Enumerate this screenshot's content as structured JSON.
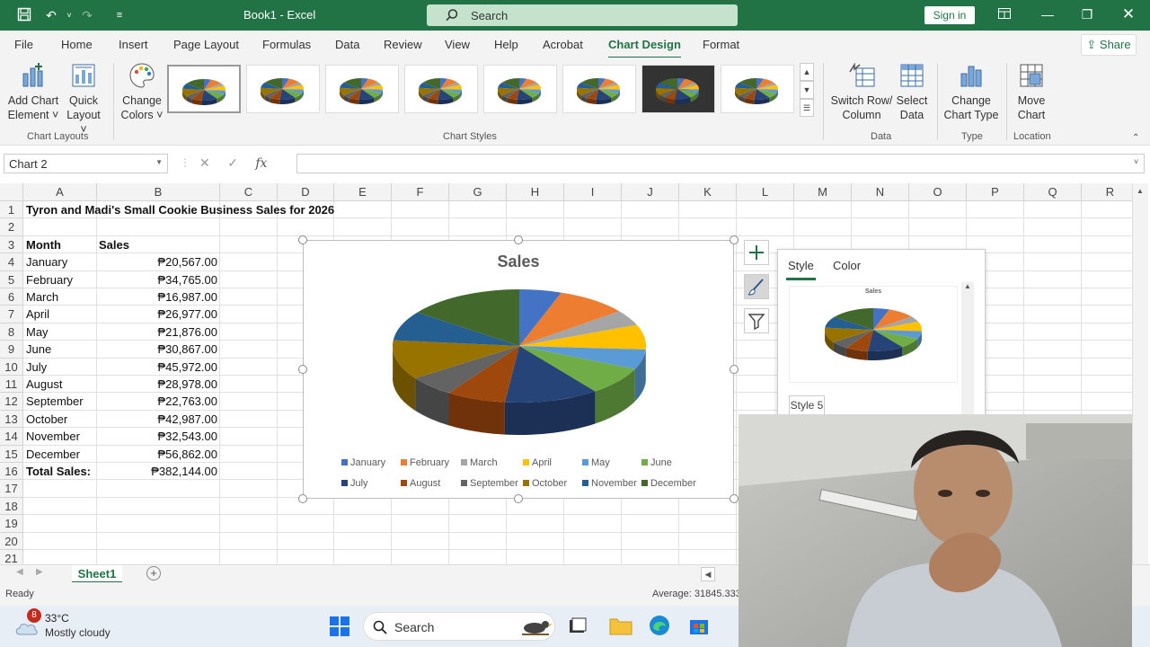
{
  "titlebar": {
    "title": "Book1  -  Excel",
    "search_placeholder": "Search",
    "signin_label": "Sign in"
  },
  "menu": {
    "tabs": [
      "File",
      "Home",
      "Insert",
      "Page Layout",
      "Formulas",
      "Data",
      "Review",
      "View",
      "Help",
      "Acrobat",
      "Chart Design",
      "Format"
    ],
    "active": "Chart Design",
    "share_label": "Share"
  },
  "ribbon": {
    "add_chart_element": [
      "Add Chart",
      "Element ˅"
    ],
    "quick_layout": [
      "Quick",
      "Layout ˅"
    ],
    "change_colors": [
      "Change",
      "Colors ˅"
    ],
    "chart_layouts_group": "Chart Layouts",
    "chart_styles_group": "Chart Styles",
    "switch_row_column": [
      "Switch Row/",
      "Column"
    ],
    "select_data": [
      "Select",
      "Data"
    ],
    "data_group": "Data",
    "change_chart_type": [
      "Change",
      "Chart Type"
    ],
    "type_group": "Type",
    "move_chart": [
      "Move",
      "Chart"
    ],
    "location_group": "Location"
  },
  "formula": {
    "name_box": "Chart 2",
    "fx": "fx"
  },
  "columns": [
    "A",
    "B",
    "C",
    "D",
    "E",
    "F",
    "G",
    "H",
    "I",
    "J",
    "K",
    "L",
    "M",
    "N",
    "O",
    "P",
    "Q",
    "R"
  ],
  "rows": [
    "1",
    "2",
    "3",
    "4",
    "5",
    "6",
    "7",
    "8",
    "9",
    "10",
    "11",
    "12",
    "13",
    "14",
    "15",
    "16",
    "17",
    "18",
    "19",
    "20",
    "21"
  ],
  "sheet": {
    "title": "Tyron and Madi's Small Cookie Business Sales for 2026",
    "header_month": "Month",
    "header_sales": "Sales",
    "data": [
      {
        "month": "January",
        "sales": "₱20,567.00"
      },
      {
        "month": "February",
        "sales": "₱34,765.00"
      },
      {
        "month": "March",
        "sales": "₱16,987.00"
      },
      {
        "month": "April",
        "sales": "₱26,977.00"
      },
      {
        "month": "May",
        "sales": "₱21,876.00"
      },
      {
        "month": "June",
        "sales": "₱30,867.00"
      },
      {
        "month": "July",
        "sales": "₱45,972.00"
      },
      {
        "month": "August",
        "sales": "₱28,978.00"
      },
      {
        "month": "September",
        "sales": "₱22,763.00"
      },
      {
        "month": "October",
        "sales": "₱42,987.00"
      },
      {
        "month": "November",
        "sales": "₱32,543.00"
      },
      {
        "month": "December",
        "sales": "₱56,862.00"
      }
    ],
    "total_label": "Total Sales:",
    "total_value": "₱382,144.00"
  },
  "chart_data": {
    "type": "pie",
    "title": "Sales",
    "categories": [
      "January",
      "February",
      "March",
      "April",
      "May",
      "June",
      "July",
      "August",
      "September",
      "October",
      "November",
      "December"
    ],
    "values": [
      20567,
      34765,
      16987,
      26977,
      21876,
      30867,
      45972,
      28978,
      22763,
      42987,
      32543,
      56862
    ],
    "colors": [
      "#4472c4",
      "#ed7d31",
      "#a5a5a5",
      "#ffc000",
      "#5b9bd5",
      "#70ad47",
      "#264478",
      "#9e480e",
      "#636363",
      "#997300",
      "#255e91",
      "#43682b"
    ],
    "legend_position": "bottom"
  },
  "style_pane": {
    "tabs": [
      "Style",
      "Color"
    ],
    "active": "Style",
    "hover_label": "Style 5",
    "thumb_title": "Sales"
  },
  "sheet_tabs": {
    "active": "Sheet1"
  },
  "status": {
    "ready": "Ready",
    "average": "Average: 31845.3333"
  },
  "taskbar": {
    "badge": "8",
    "temperature": "33°C",
    "weather": "Mostly cloudy",
    "search_label": "Search"
  }
}
